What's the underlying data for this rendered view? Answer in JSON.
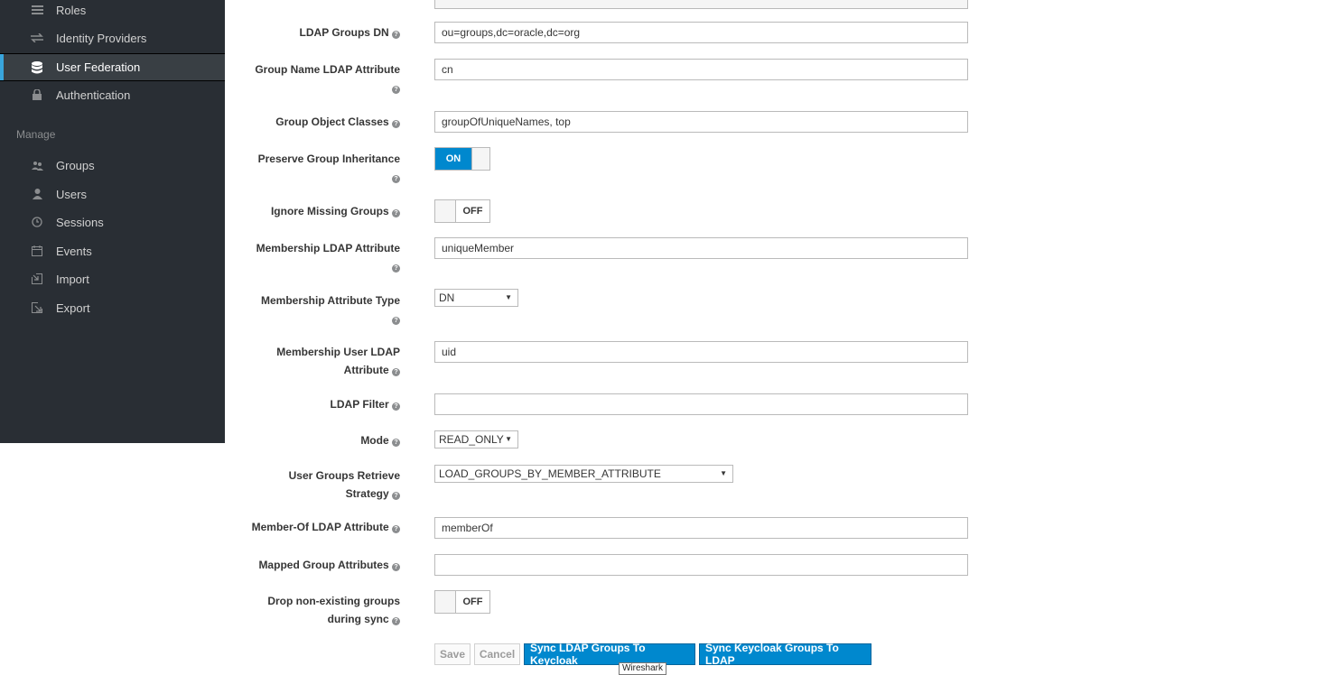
{
  "sidebar": {
    "items": [
      {
        "label": "Roles",
        "icon": "list-icon"
      },
      {
        "label": "Identity Providers",
        "icon": "exchange-icon"
      },
      {
        "label": "User Federation",
        "icon": "database-icon",
        "active": true
      },
      {
        "label": "Authentication",
        "icon": "lock-icon"
      }
    ],
    "manage_title": "Manage",
    "manage_items": [
      {
        "label": "Groups",
        "icon": "groups-icon"
      },
      {
        "label": "Users",
        "icon": "user-icon"
      },
      {
        "label": "Sessions",
        "icon": "clock-icon"
      },
      {
        "label": "Events",
        "icon": "calendar-icon"
      },
      {
        "label": "Import",
        "icon": "import-icon"
      },
      {
        "label": "Export",
        "icon": "export-icon"
      }
    ]
  },
  "form": {
    "ldap_groups_dn": {
      "label": "LDAP Groups DN",
      "value": "ou=groups,dc=oracle,dc=org"
    },
    "group_name_attr": {
      "label_1": "Group Name LDAP Attribute",
      "value": "cn"
    },
    "group_object_classes": {
      "label": "Group Object Classes",
      "value": "groupOfUniqueNames, top"
    },
    "preserve_inheritance": {
      "label": "Preserve Group Inheritance",
      "state": "ON"
    },
    "ignore_missing": {
      "label": "Ignore Missing Groups",
      "state": "OFF"
    },
    "membership_attr": {
      "label": "Membership LDAP Attribute",
      "value": "uniqueMember"
    },
    "membership_attr_type": {
      "label": "Membership Attribute Type",
      "value": "DN"
    },
    "membership_user_attr": {
      "label_1": "Membership User LDAP",
      "label_2": "Attribute",
      "value": "uid"
    },
    "ldap_filter": {
      "label": "LDAP Filter",
      "value": ""
    },
    "mode": {
      "label": "Mode",
      "value": "READ_ONLY"
    },
    "retrieve_strategy": {
      "label_1": "User Groups Retrieve",
      "label_2": "Strategy",
      "value": "LOAD_GROUPS_BY_MEMBER_ATTRIBUTE"
    },
    "member_of_attr": {
      "label": "Member-Of LDAP Attribute",
      "value": "memberOf"
    },
    "mapped_group_attrs": {
      "label": "Mapped Group Attributes",
      "value": ""
    },
    "drop_nonexisting": {
      "label_1": "Drop non-existing groups",
      "label_2": "during sync",
      "state": "OFF"
    }
  },
  "buttons": {
    "save": "Save",
    "cancel": "Cancel",
    "sync_to_keycloak": "Sync LDAP Groups To Keycloak",
    "sync_to_ldap": "Sync Keycloak Groups To LDAP"
  },
  "tooltip": "Wireshark",
  "help_glyph": "?"
}
